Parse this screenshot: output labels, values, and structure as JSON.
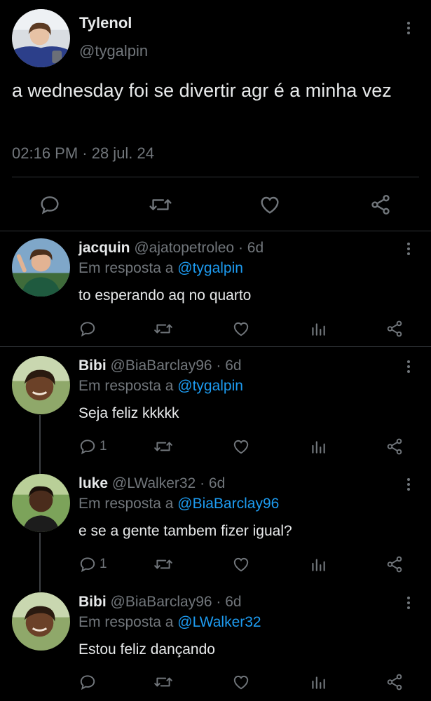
{
  "main_tweet": {
    "display_name": "Tylenol",
    "handle": "@tygalpin",
    "text": "a wednesday foi se divertir agr é a minha vez",
    "timestamp": "02:16 PM · 28 jul. 24"
  },
  "replies": [
    {
      "display_name": "jacquin",
      "handle_meta": "@ajatopetroleo · 6d",
      "reply_prefix": "Em resposta a",
      "reply_mention": "@tygalpin",
      "text": "to esperando aq no quarto",
      "reply_count": ""
    },
    {
      "display_name": "Bibi",
      "handle_meta": "@BiaBarclay96 · 6d",
      "reply_prefix": "Em resposta a",
      "reply_mention": "@tygalpin",
      "text": "Seja feliz kkkkk",
      "reply_count": "1"
    },
    {
      "display_name": "luke",
      "handle_meta": "@LWalker32 · 6d",
      "reply_prefix": "Em resposta a",
      "reply_mention": "@BiaBarclay96",
      "text": "e se a gente tambem fizer igual?",
      "reply_count": "1"
    },
    {
      "display_name": "Bibi",
      "handle_meta": "@BiaBarclay96 · 6d",
      "reply_prefix": "Em resposta a",
      "reply_mention": "@LWalker32",
      "text": "Estou feliz dançando",
      "reply_count": ""
    }
  ],
  "icons": {
    "reply": "reply-icon",
    "retweet": "retweet-icon",
    "like": "heart-icon",
    "views": "views-icon",
    "share": "share-icon",
    "more": "more-vertical-icon"
  },
  "colors": {
    "background": "#000000",
    "text": "#e7e9ea",
    "muted": "#71767b",
    "mention": "#1d9bf0",
    "divider": "#2f3336"
  }
}
